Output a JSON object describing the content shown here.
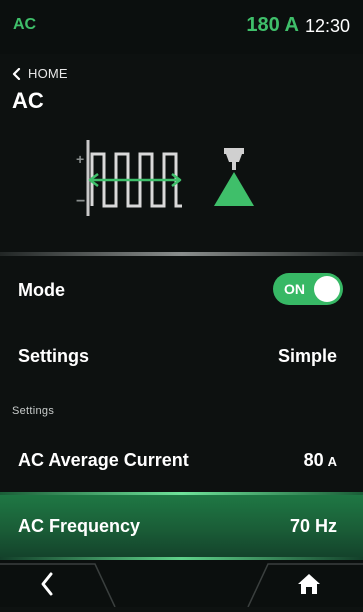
{
  "status": {
    "mode": "AC",
    "current": "180 A",
    "time": "12:30"
  },
  "nav": {
    "back_label": "HOME"
  },
  "page": {
    "title": "AC"
  },
  "mode_row": {
    "label": "Mode",
    "toggle_text": "ON",
    "toggle_state": "on"
  },
  "settings_row": {
    "label": "Settings",
    "value": "Simple"
  },
  "section": {
    "label": "Settings"
  },
  "ac_current_row": {
    "label": "AC Average Current",
    "value": "80",
    "unit": "A"
  },
  "ac_frequency_row": {
    "label": "AC Frequency",
    "value": "70 Hz"
  },
  "diagram": {
    "plus": "+",
    "minus": "−"
  },
  "colors": {
    "accent": "#3fbf6a",
    "highlight": "#1f7a45",
    "background": "#0d1110"
  },
  "icons": {
    "back": "chevron-left-icon",
    "home": "home-icon",
    "torch": "tig-torch-icon",
    "waveform": "ac-square-wave-icon"
  }
}
